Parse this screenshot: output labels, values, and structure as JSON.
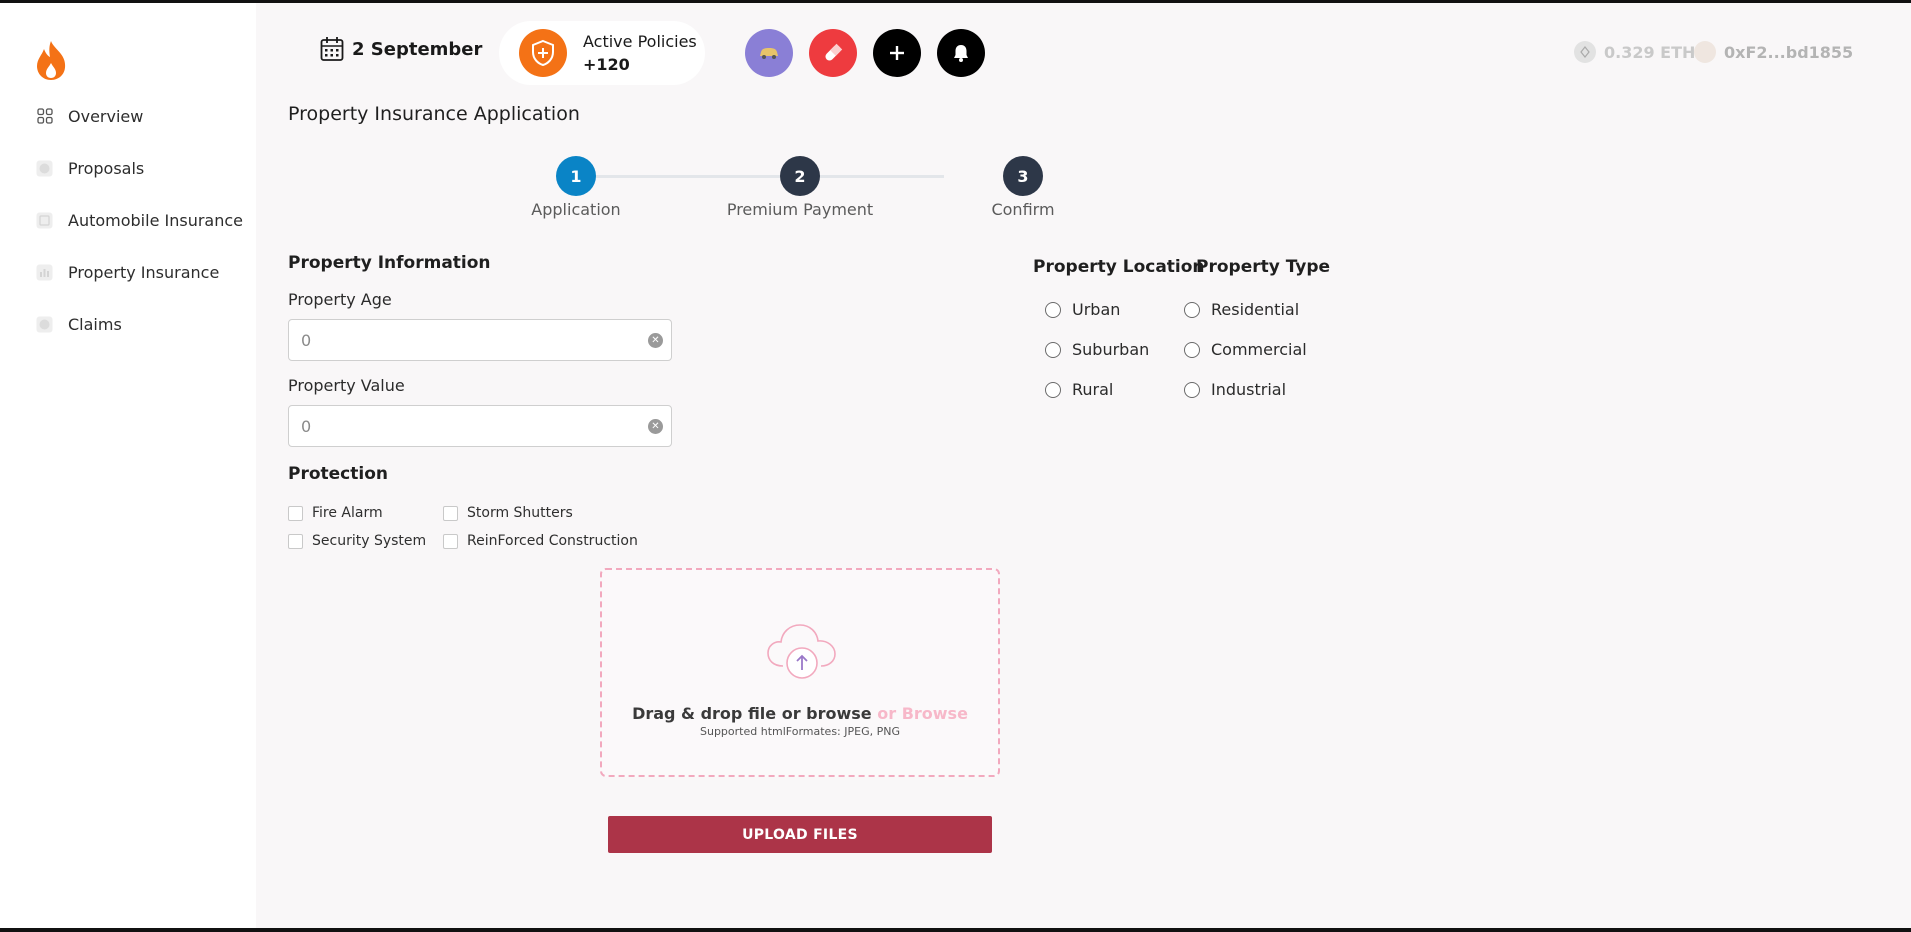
{
  "sidebar": {
    "items": [
      {
        "label": "Overview",
        "icon": "grid-icon"
      },
      {
        "label": "Proposals",
        "icon": "chat-icon"
      },
      {
        "label": "Automobile Insurance",
        "icon": "document-icon"
      },
      {
        "label": "Property Insurance",
        "icon": "bar-chart-icon"
      },
      {
        "label": "Claims",
        "icon": "chat-icon"
      }
    ]
  },
  "header": {
    "date": "2 September",
    "policies_label": "Active Policies",
    "policies_count": "+120",
    "wallet_balance": "0.329 ETH",
    "wallet_address": "0xF2...bd1855"
  },
  "colors": {
    "accent_orange": "#f47216",
    "step_active": "#0a84c6",
    "step_inactive": "#2d3748",
    "upload_button": "#ac3448",
    "dropzone_border": "#f2a9be"
  },
  "page": {
    "title": "Property Insurance Application"
  },
  "stepper": {
    "steps": [
      {
        "number": "1",
        "label": "Application"
      },
      {
        "number": "2",
        "label": "Premium Payment"
      },
      {
        "number": "3",
        "label": "Confirm"
      }
    ]
  },
  "form": {
    "info_heading": "Property Information",
    "age_label": "Property Age",
    "age_value": "0",
    "value_label": "Property Value",
    "value_value": "0",
    "protection_heading": "Protection",
    "protection": [
      "Fire Alarm",
      "Storm Shutters",
      "Security System",
      "ReinForced Construction"
    ],
    "location_heading": "Property Location",
    "locations": [
      "Urban",
      "Suburban",
      "Rural"
    ],
    "type_heading": "Property Type",
    "types": [
      "Residential",
      "Commercial",
      "Industrial"
    ]
  },
  "upload": {
    "drop_text": "Drag & drop file or browse",
    "browse_link": "or Browse",
    "formats": "Supported htmlFormates: JPEG, PNG",
    "button_label": "UPLOAD FILES"
  }
}
